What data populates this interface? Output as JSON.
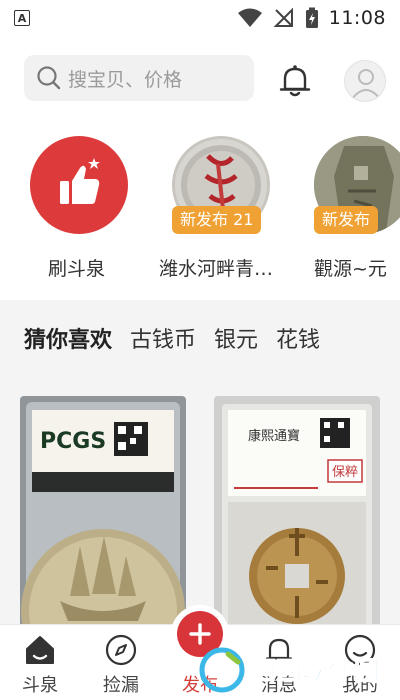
{
  "status_bar": {
    "time": "11:08",
    "notification_letter": "A"
  },
  "search": {
    "placeholder": "搜宝贝、价格"
  },
  "shortcuts": [
    {
      "label": "刷斗泉",
      "badge": ""
    },
    {
      "label": "潍水河畔青…",
      "badge": "新发布 21"
    },
    {
      "label": "觀源~元",
      "badge": "新发布"
    }
  ],
  "tabs": [
    {
      "label": "猜你喜欢",
      "active": true
    },
    {
      "label": "古钱币",
      "active": false
    },
    {
      "label": "银元",
      "active": false
    },
    {
      "label": "花钱",
      "active": false
    }
  ],
  "cards": [
    {
      "slab_brand": "PCGS"
    },
    {
      "slab_text": "康熙通寶",
      "slab_label": "保粹"
    }
  ],
  "bottom_nav": [
    {
      "label": "斗泉",
      "icon": "home-icon"
    },
    {
      "label": "捡漏",
      "icon": "compass-icon"
    },
    {
      "label": "发布",
      "icon": "plus-icon"
    },
    {
      "label": "消息",
      "icon": "bell-icon"
    },
    {
      "label": "我的",
      "icon": "smiley-icon"
    }
  ],
  "watermark": {
    "text": "西西软件园"
  },
  "colors": {
    "accent_red": "#d43f3a",
    "badge_orange": "#f0a133",
    "background_gray": "#f4f4f4"
  }
}
